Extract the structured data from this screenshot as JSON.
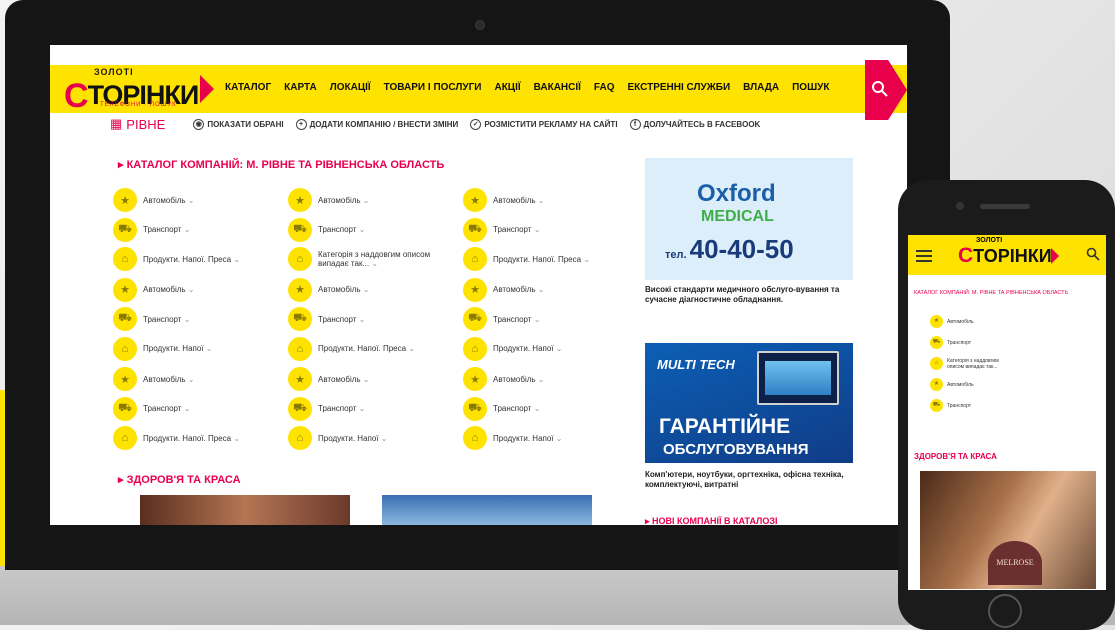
{
  "logo": {
    "top": "ЗОЛОТІ",
    "initial": "С",
    "main": "ТОРІНКИ",
    "sub": "ТЕЛЕФОНИ · ПОШУК"
  },
  "nav": [
    "КАТАЛОГ",
    "КАРТА",
    "ЛОКАЦІЇ",
    "ТОВАРИ І ПОСЛУГИ",
    "АКЦІЇ",
    "ВАКАНСІЇ",
    "FAQ",
    "ЕКСТРЕННІ СЛУЖБИ",
    "ВЛАДА",
    "ПОШУК"
  ],
  "subbar": {
    "city": "РІВНЕ",
    "items": [
      "ПОКАЗАТИ ОБРАНІ",
      "ДОДАТИ КОМПАНІЮ / ВНЕСТИ ЗМІНИ",
      "РОЗМІСТИТИ РЕКЛАМУ НА САЙТІ",
      "ДОЛУЧАЙТЕСЬ В FACEBOOK"
    ]
  },
  "catalog_title": "КАТАЛОГ КОМПАНІЙ: М. РІВНЕ ТА РІВНЕНСЬКА ОБЛАСТЬ",
  "categories": [
    [
      "Автомобіль",
      "Автомобіль",
      "Автомобіль"
    ],
    [
      "Транспорт",
      "Транспорт",
      "Транспорт"
    ],
    [
      "Продукти. Напої. Преса",
      "Категорія з наддовгим описом випадає так...",
      "Продукти. Напої. Преса"
    ],
    [
      "Автомобіль",
      "Автомобіль",
      "Автомобіль"
    ],
    [
      "Транспорт",
      "Транспорт",
      "Транспорт"
    ],
    [
      "Продукти. Напої",
      "Продукти. Напої. Преса",
      "Продукти. Напої"
    ],
    [
      "Автомобіль",
      "Автомобіль",
      "Автомобіль"
    ],
    [
      "Транспорт",
      "Транспорт",
      "Транспорт"
    ],
    [
      "Продукти. Напої. Преса",
      "Продукти. Напої",
      "Продукти. Напої"
    ]
  ],
  "health_title": "ЗДОРОВ'Я ТА КРАСА",
  "ad1": {
    "brand": "Oxford",
    "brand2": "MEDICAL",
    "tel_prefix": "тел.",
    "tel": "40-40-50",
    "caption": "Високі стандарти медичного обслуго-вування та сучасне діагностичне обладнання."
  },
  "ad2": {
    "brand": "MULTI TECH",
    "line1": "ГАРАНТІЙНЕ",
    "line2": "ОБСЛУГОВУВАННЯ",
    "caption": "Комп'ютери, ноутбуки, оргтехніка, офісна техніка, комплектуючі, витратні"
  },
  "new_companies": "НОВІ КОМПАНІЇ В КАТАЛОЗІ",
  "phone": {
    "logo_top": "ЗОЛОТІ",
    "logo_initial": "С",
    "logo_main": "ТОРІНКИ",
    "title": "КАТАЛОГ КОМПАНІЙ: М. РІВНЕ ТА РІВНЕНСЬКА ОБЛАСТЬ",
    "cats": [
      "Автомобіль",
      "Транспорт",
      "Категорія з наддовгим описом випадає так...",
      "Автомобіль",
      "Транспорт"
    ],
    "section": "ЗДОРОВ'Я ТА КРАСА",
    "badge": "MELROSE"
  },
  "colors": {
    "brand_yellow": "#ffe300",
    "brand_pink": "#e8004c"
  }
}
